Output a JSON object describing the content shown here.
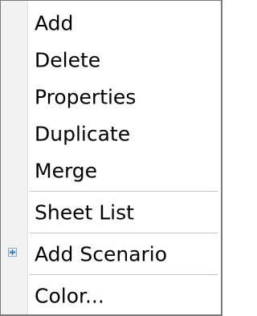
{
  "menu": {
    "items": [
      {
        "label": "Add"
      },
      {
        "label": "Delete"
      },
      {
        "label": "Properties"
      },
      {
        "label": "Duplicate"
      },
      {
        "label": "Merge"
      },
      {
        "label": "Sheet List"
      },
      {
        "label": "Add Scenario",
        "icon": "add-scenario-icon"
      },
      {
        "label": "Color..."
      }
    ]
  },
  "colors": {
    "gutter": "#f2f2f2",
    "separator": "#c6c6c6",
    "border": "#7a7a7a",
    "icon_accent": "#3a6fb0"
  }
}
